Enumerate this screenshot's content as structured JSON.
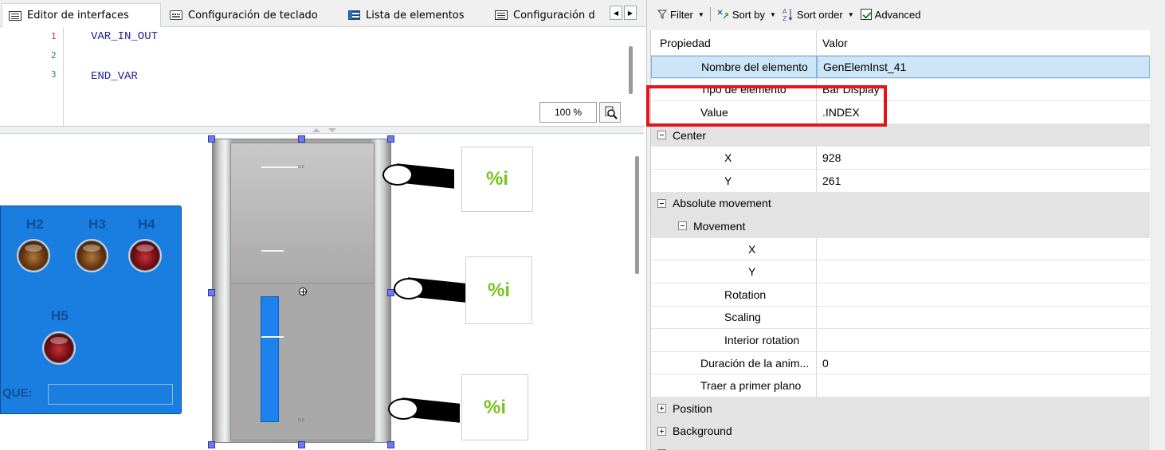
{
  "tabs": [
    {
      "label": "Editor de interfaces",
      "icon": "window-icon",
      "active": true
    },
    {
      "label": "Configuración de teclado",
      "icon": "keyboard-icon",
      "active": false
    },
    {
      "label": "Lista de elementos",
      "icon": "list-icon",
      "active": false
    },
    {
      "label": "Configuración d",
      "icon": "window-icon",
      "active": false
    }
  ],
  "code_editor": {
    "line_numbers": [
      "1",
      "2",
      "3"
    ],
    "lines": [
      "VAR_IN_OUT",
      "",
      "END_VAR"
    ],
    "zoom": "100 %"
  },
  "visualization": {
    "lamp_labels": [
      "H2",
      "H3",
      "H4",
      "H5"
    ],
    "que_label": "QUE:",
    "percent_labels": [
      "%i",
      "%i",
      "%i"
    ],
    "bar_tick_label": "0.0"
  },
  "toolbar": {
    "filter": "Filter",
    "sort_by": "Sort by",
    "sort_order": "Sort order",
    "advanced": "Advanced",
    "advanced_checked": true
  },
  "properties": {
    "header_name": "Propiedad",
    "header_value": "Valor",
    "rows": [
      {
        "name": "Nombre del elemento",
        "value": "GenElemInst_41",
        "indent": 1,
        "type": "prop",
        "selected": true
      },
      {
        "name": "Tipo de elemento",
        "value": "Bar Display",
        "indent": 1,
        "type": "prop"
      },
      {
        "name": "Value",
        "value": ".INDEX",
        "indent": 1,
        "type": "prop"
      },
      {
        "name": "Center",
        "value": "",
        "indent": 0,
        "type": "cat",
        "expander": "minus"
      },
      {
        "name": "X",
        "value": "928",
        "indent": 2,
        "type": "prop"
      },
      {
        "name": "Y",
        "value": "261",
        "indent": 2,
        "type": "prop"
      },
      {
        "name": "Absolute movement",
        "value": "",
        "indent": 0,
        "type": "cat",
        "expander": "minus"
      },
      {
        "name": "Movement",
        "value": "",
        "indent": 1,
        "type": "cat",
        "expander": "minus"
      },
      {
        "name": "X",
        "value": "",
        "indent": 3,
        "type": "prop"
      },
      {
        "name": "Y",
        "value": "",
        "indent": 3,
        "type": "prop"
      },
      {
        "name": "Rotation",
        "value": "",
        "indent": 2,
        "type": "prop"
      },
      {
        "name": "Scaling",
        "value": "",
        "indent": 2,
        "type": "prop"
      },
      {
        "name": "Interior rotation",
        "value": "",
        "indent": 2,
        "type": "prop"
      },
      {
        "name": "Duración de la anim...",
        "value": "0",
        "indent": 1,
        "type": "prop"
      },
      {
        "name": "Traer a primer plano",
        "value": "",
        "indent": 1,
        "type": "prop"
      },
      {
        "name": "Position",
        "value": "",
        "indent": 0,
        "type": "cat",
        "expander": "plus"
      },
      {
        "name": "Background",
        "value": "",
        "indent": 0,
        "type": "cat",
        "expander": "plus"
      },
      {
        "name": "",
        "value": "",
        "indent": 0,
        "type": "cat",
        "expander": "plus"
      }
    ]
  },
  "colors": {
    "highlight": "#e3151b",
    "panel_blue": "#1a7de0",
    "bar_fill": "#1b82ee",
    "percent_green": "#7ac31e"
  }
}
